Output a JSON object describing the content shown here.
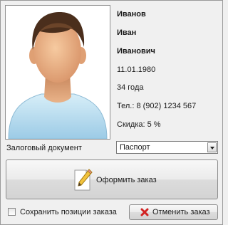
{
  "customer": {
    "last_name": "Иванов",
    "first_name": "Иван",
    "patronymic": "Иванович",
    "birth_date": "11.01.1980",
    "age": "34 года",
    "phone": "Тел.: 8 (902) 1234 567",
    "discount": "Скидка: 5 %"
  },
  "deposit": {
    "label": "Залоговый документ",
    "selected": "Паспорт"
  },
  "actions": {
    "place_order_label": "Оформить заказ",
    "save_positions_label": "Сохранить позиции заказа",
    "save_positions_checked": false,
    "cancel_order_label": "Отменить заказ"
  },
  "icons": {
    "photo": "avatar-placeholder",
    "place_order": "pencil-paper-icon",
    "cancel_order": "red-x-icon"
  }
}
